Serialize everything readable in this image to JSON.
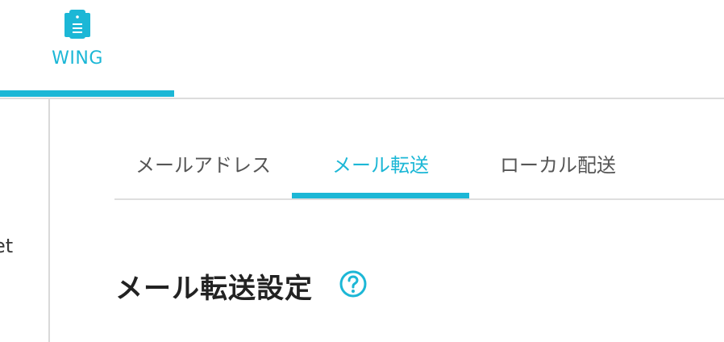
{
  "header": {
    "app_tab": {
      "label": "WING",
      "icon": "server-icon"
    }
  },
  "sidebar": {
    "partial_label": "et"
  },
  "sub_tabs": [
    {
      "label": "メールアドレス",
      "active": false
    },
    {
      "label": "メール転送",
      "active": true
    },
    {
      "label": "ローカル配送",
      "active": false
    }
  ],
  "main": {
    "section_title": "メール転送設定",
    "help_icon": "help-circle-icon"
  },
  "colors": {
    "accent": "#1cb7d6",
    "text": "#555555",
    "title": "#222222",
    "divider": "#dcdcdc"
  }
}
